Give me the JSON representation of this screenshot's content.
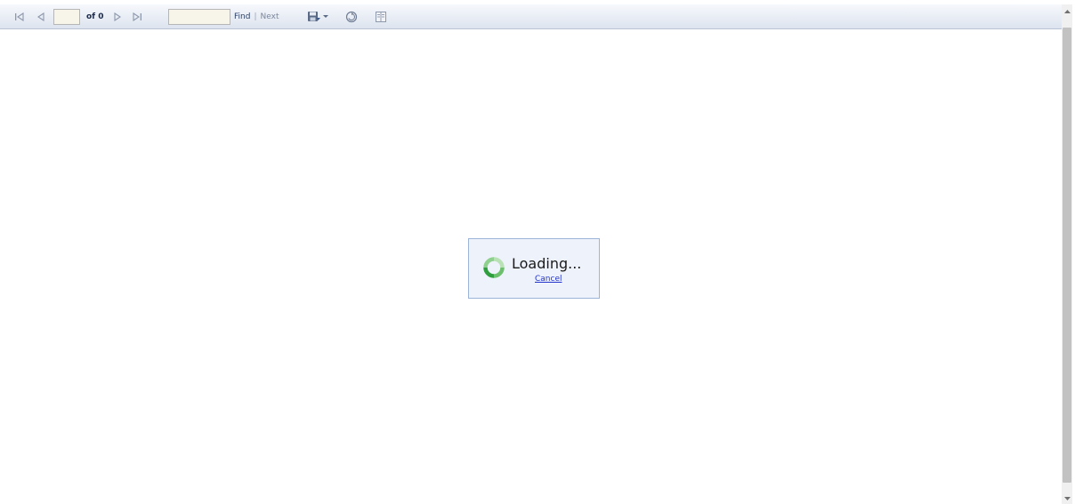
{
  "toolbar": {
    "page_of_label": "of 0",
    "find_label": "Find",
    "separator": "|",
    "next_label": "Next",
    "page_input_value": "",
    "find_input_value": ""
  },
  "loading": {
    "text": "Loading...",
    "cancel_label": "Cancel"
  },
  "icons": {
    "first_page": "first-page-icon",
    "prev_page": "previous-page-icon",
    "next_page": "next-page-icon",
    "last_page": "last-page-icon",
    "export": "save-export-icon",
    "refresh": "refresh-icon",
    "print_layout": "print-layout-icon"
  },
  "colors": {
    "toolbar_top": "#f6f8fc",
    "toolbar_bottom": "#dde4ef",
    "loading_bg": "#eef2fa",
    "loading_border": "#9db4d9",
    "cancel_link": "#2233cc",
    "spinner_green": "#2e9e3e"
  }
}
